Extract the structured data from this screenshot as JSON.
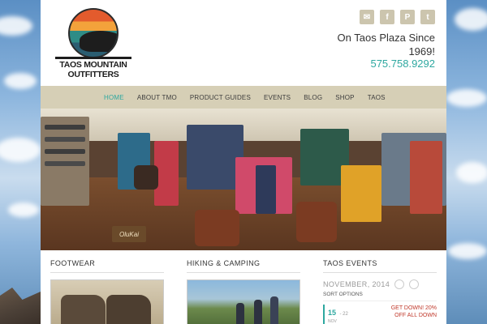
{
  "brand": {
    "line1": "TAOS MOUNTAIN",
    "line2": "OUTFITTERS"
  },
  "social": [
    {
      "name": "email-icon",
      "glyph": "✉"
    },
    {
      "name": "facebook-icon",
      "glyph": "f"
    },
    {
      "name": "pinterest-icon",
      "glyph": "P"
    },
    {
      "name": "twitter-icon",
      "glyph": "t"
    }
  ],
  "header": {
    "tagline": "On Taos Plaza Since 1969!",
    "phone": "575.758.9292"
  },
  "nav": {
    "items": [
      {
        "label": "HOME",
        "active": true
      },
      {
        "label": "ABOUT TMO",
        "active": false
      },
      {
        "label": "PRODUCT GUIDES",
        "active": false
      },
      {
        "label": "EVENTS",
        "active": false
      },
      {
        "label": "BLOG",
        "active": false
      },
      {
        "label": "SHOP",
        "active": false
      },
      {
        "label": "TAOS",
        "active": false
      }
    ]
  },
  "hero": {
    "sign_text": "OluKai"
  },
  "sections": {
    "footwear_title": "FOOTWEAR",
    "hiking_title": "HIKING & CAMPING",
    "events_title": "TAOS EVENTS"
  },
  "events": {
    "month": "NOVEMBER, 2014",
    "sort_label": "SORT OPTIONS",
    "first_event": {
      "day": "15",
      "dash": "- 22",
      "month": "NOV",
      "title_line1": "GET DOWN! 20%",
      "title_line2": "OFF ALL DOWN"
    }
  },
  "colors": {
    "accent": "#2ea8a0",
    "nav_bg": "#d6cfb6",
    "social_bg": "#ccc5ae"
  }
}
